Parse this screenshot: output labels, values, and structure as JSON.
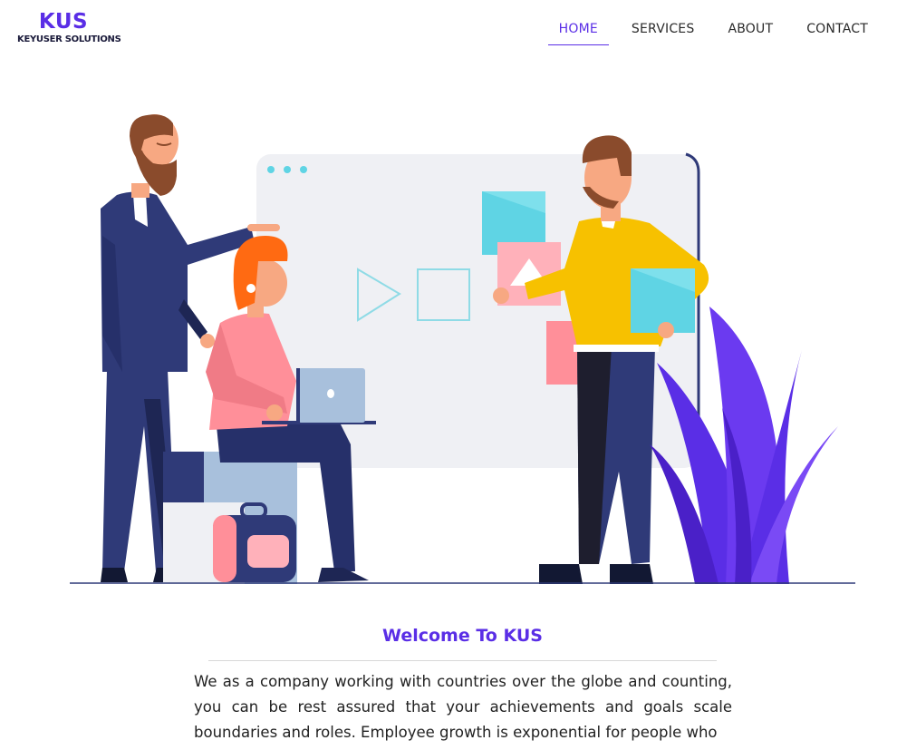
{
  "logo": {
    "title": "KUS",
    "subtitle": "KEYUSER SOLUTIONS"
  },
  "nav": {
    "items": [
      "HOME",
      "SERVICES",
      "ABOUT",
      "CONTACT"
    ],
    "active": "HOME"
  },
  "hero": {
    "illustration": "team-collaboration-illustration"
  },
  "welcome": {
    "title": "Welcome To KUS",
    "body": "We as a company working with countries over the globe and counting, you can be rest assured that your achievements and goals scale boundaries and roles. Employee growth is exponential for people who"
  },
  "colors": {
    "accent": "#5a2ee6",
    "navy": "#2f3a78",
    "yellow": "#f7c100",
    "pink": "#ff8f99",
    "cyan": "#5fd4e4"
  }
}
